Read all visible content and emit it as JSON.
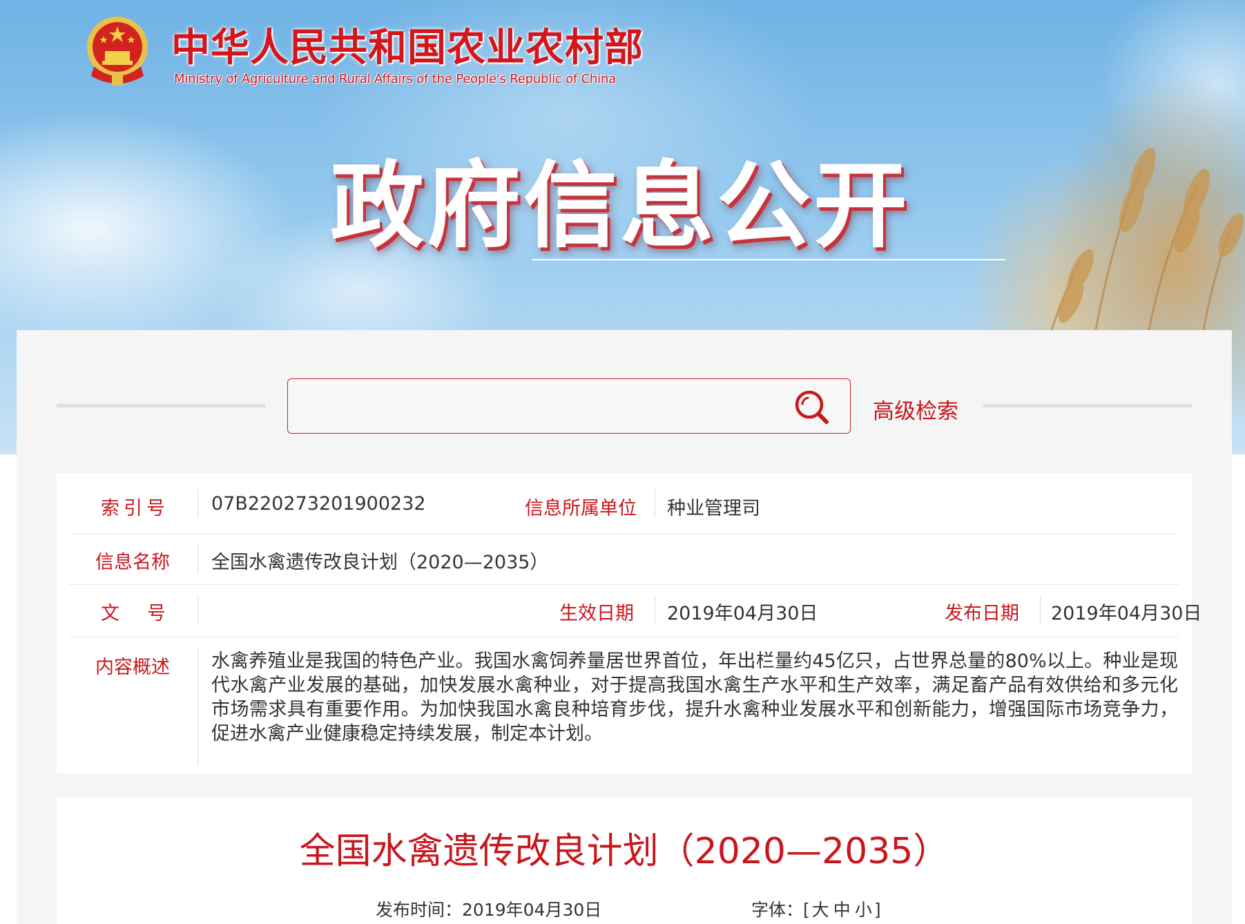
{
  "header": {
    "site_title_cn": "中华人民共和国农业农村部",
    "site_title_en": "Ministry of Agriculture and Rural Affairs of the People's Republic of China",
    "section_title": "政府信息公开"
  },
  "search": {
    "placeholder": "",
    "advanced_label": "高级检索"
  },
  "info": {
    "index_label": "索引号",
    "index_value": "07B220273201900232",
    "unit_label": "信息所属单位",
    "unit_value": "种业管理司",
    "name_label": "信息名称",
    "name_value": "全国水禽遗传改良计划（2020—2035）",
    "docno_label": "文号",
    "effective_label": "生效日期",
    "effective_value": "2019年04月30日",
    "publish_label": "发布日期",
    "publish_value": "2019年04月30日",
    "summary_label": "内容概述",
    "summary_value": "水禽养殖业是我国的特色产业。我国水禽饲养量居世界首位，年出栏量约45亿只，占世界总量的80%以上。种业是现代水禽产业发展的基础，加快发展水禽种业，对于提高我国水禽生产水平和生产效率，满足畜产品有效供给和多元化市场需求具有重要作用。为加快我国水禽良种培育步伐，提升水禽种业发展水平和创新能力，增强国际市场竞争力，促进水禽产业健康稳定持续发展，制定本计划。"
  },
  "article": {
    "title": "全国水禽遗传改良计划（2020—2035）",
    "publish_time_label": "发布时间：",
    "publish_time_value": "2019年04月30日",
    "font_label": "字体：",
    "font_open": "[",
    "font_large": "大",
    "font_medium": "中",
    "font_small": "小",
    "font_close": "]"
  },
  "colors": {
    "accent_red": "#c8161d",
    "panel_bg": "#f5f5f5",
    "text": "#333333"
  }
}
